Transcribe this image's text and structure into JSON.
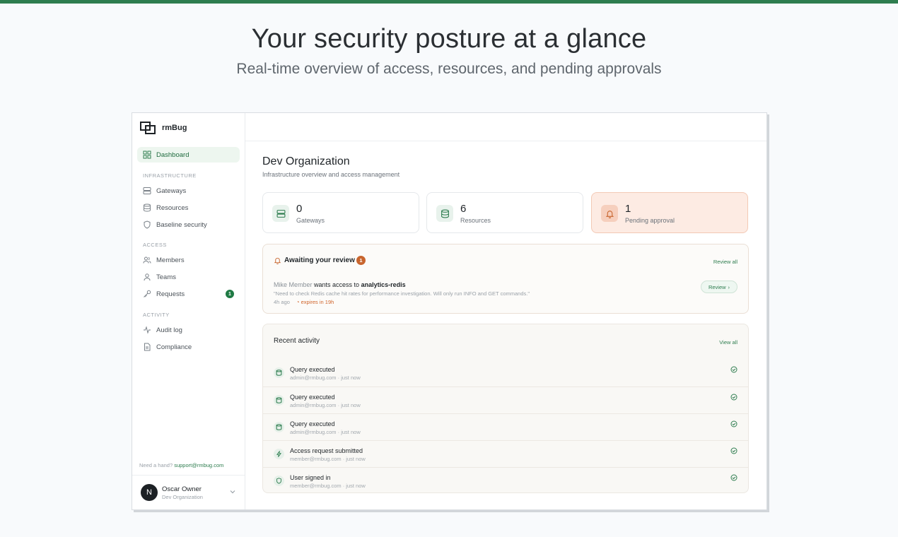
{
  "hero": {
    "title": "Your security posture at a glance",
    "subtitle": "Real-time overview of access, resources, and pending approvals"
  },
  "colors": {
    "accent": "#2e7d4f",
    "pending_bg": "#fdebe3",
    "warning": "#c8652e"
  },
  "sidebar": {
    "brand": "rmBug",
    "dashboard": "Dashboard",
    "sections": {
      "infrastructure": "INFRASTRUCTURE",
      "access": "ACCESS",
      "activity": "ACTIVITY"
    },
    "items": {
      "gateways": "Gateways",
      "resources": "Resources",
      "baseline": "Baseline security",
      "members": "Members",
      "teams": "Teams",
      "requests": "Requests",
      "requests_badge": "1",
      "audit": "Audit log",
      "compliance": "Compliance"
    },
    "help_prefix": "Need a hand?",
    "help_link": "support@rmbug.com",
    "user": {
      "initial": "N",
      "name": "Oscar Owner",
      "org": "Dev Organization"
    }
  },
  "main": {
    "title": "Dev Organization",
    "subtitle": "Infrastructure overview and access management",
    "stats": [
      {
        "value": "0",
        "label": "Gateways",
        "icon": "server-icon"
      },
      {
        "value": "6",
        "label": "Resources",
        "icon": "database-icon"
      },
      {
        "value": "1",
        "label": "Pending approval",
        "icon": "bell-icon"
      }
    ],
    "review": {
      "title": "Awaiting your review",
      "count": "1",
      "review_all": "Review all",
      "requester": "Mike Member",
      "action": "wants access to",
      "resource": "analytics-redis",
      "quote": "\"Need to check Redis cache hit rates for performance investigation. Will only run INFO and GET commands.\"",
      "time": "4h ago",
      "expires": "expires in 19h",
      "button": "Review"
    },
    "activity": {
      "title": "Recent activity",
      "view_all": "View all",
      "rows": [
        {
          "title": "Query executed",
          "meta": "admin@rmbug.com · just now",
          "icon": "database-icon"
        },
        {
          "title": "Query executed",
          "meta": "admin@rmbug.com · just now",
          "icon": "database-icon"
        },
        {
          "title": "Query executed",
          "meta": "admin@rmbug.com · just now",
          "icon": "database-icon"
        },
        {
          "title": "Access request submitted",
          "meta": "member@rmbug.com · just now",
          "icon": "lightning-icon"
        },
        {
          "title": "User signed in",
          "meta": "member@rmbug.com · just now",
          "icon": "shield-icon"
        }
      ]
    }
  }
}
